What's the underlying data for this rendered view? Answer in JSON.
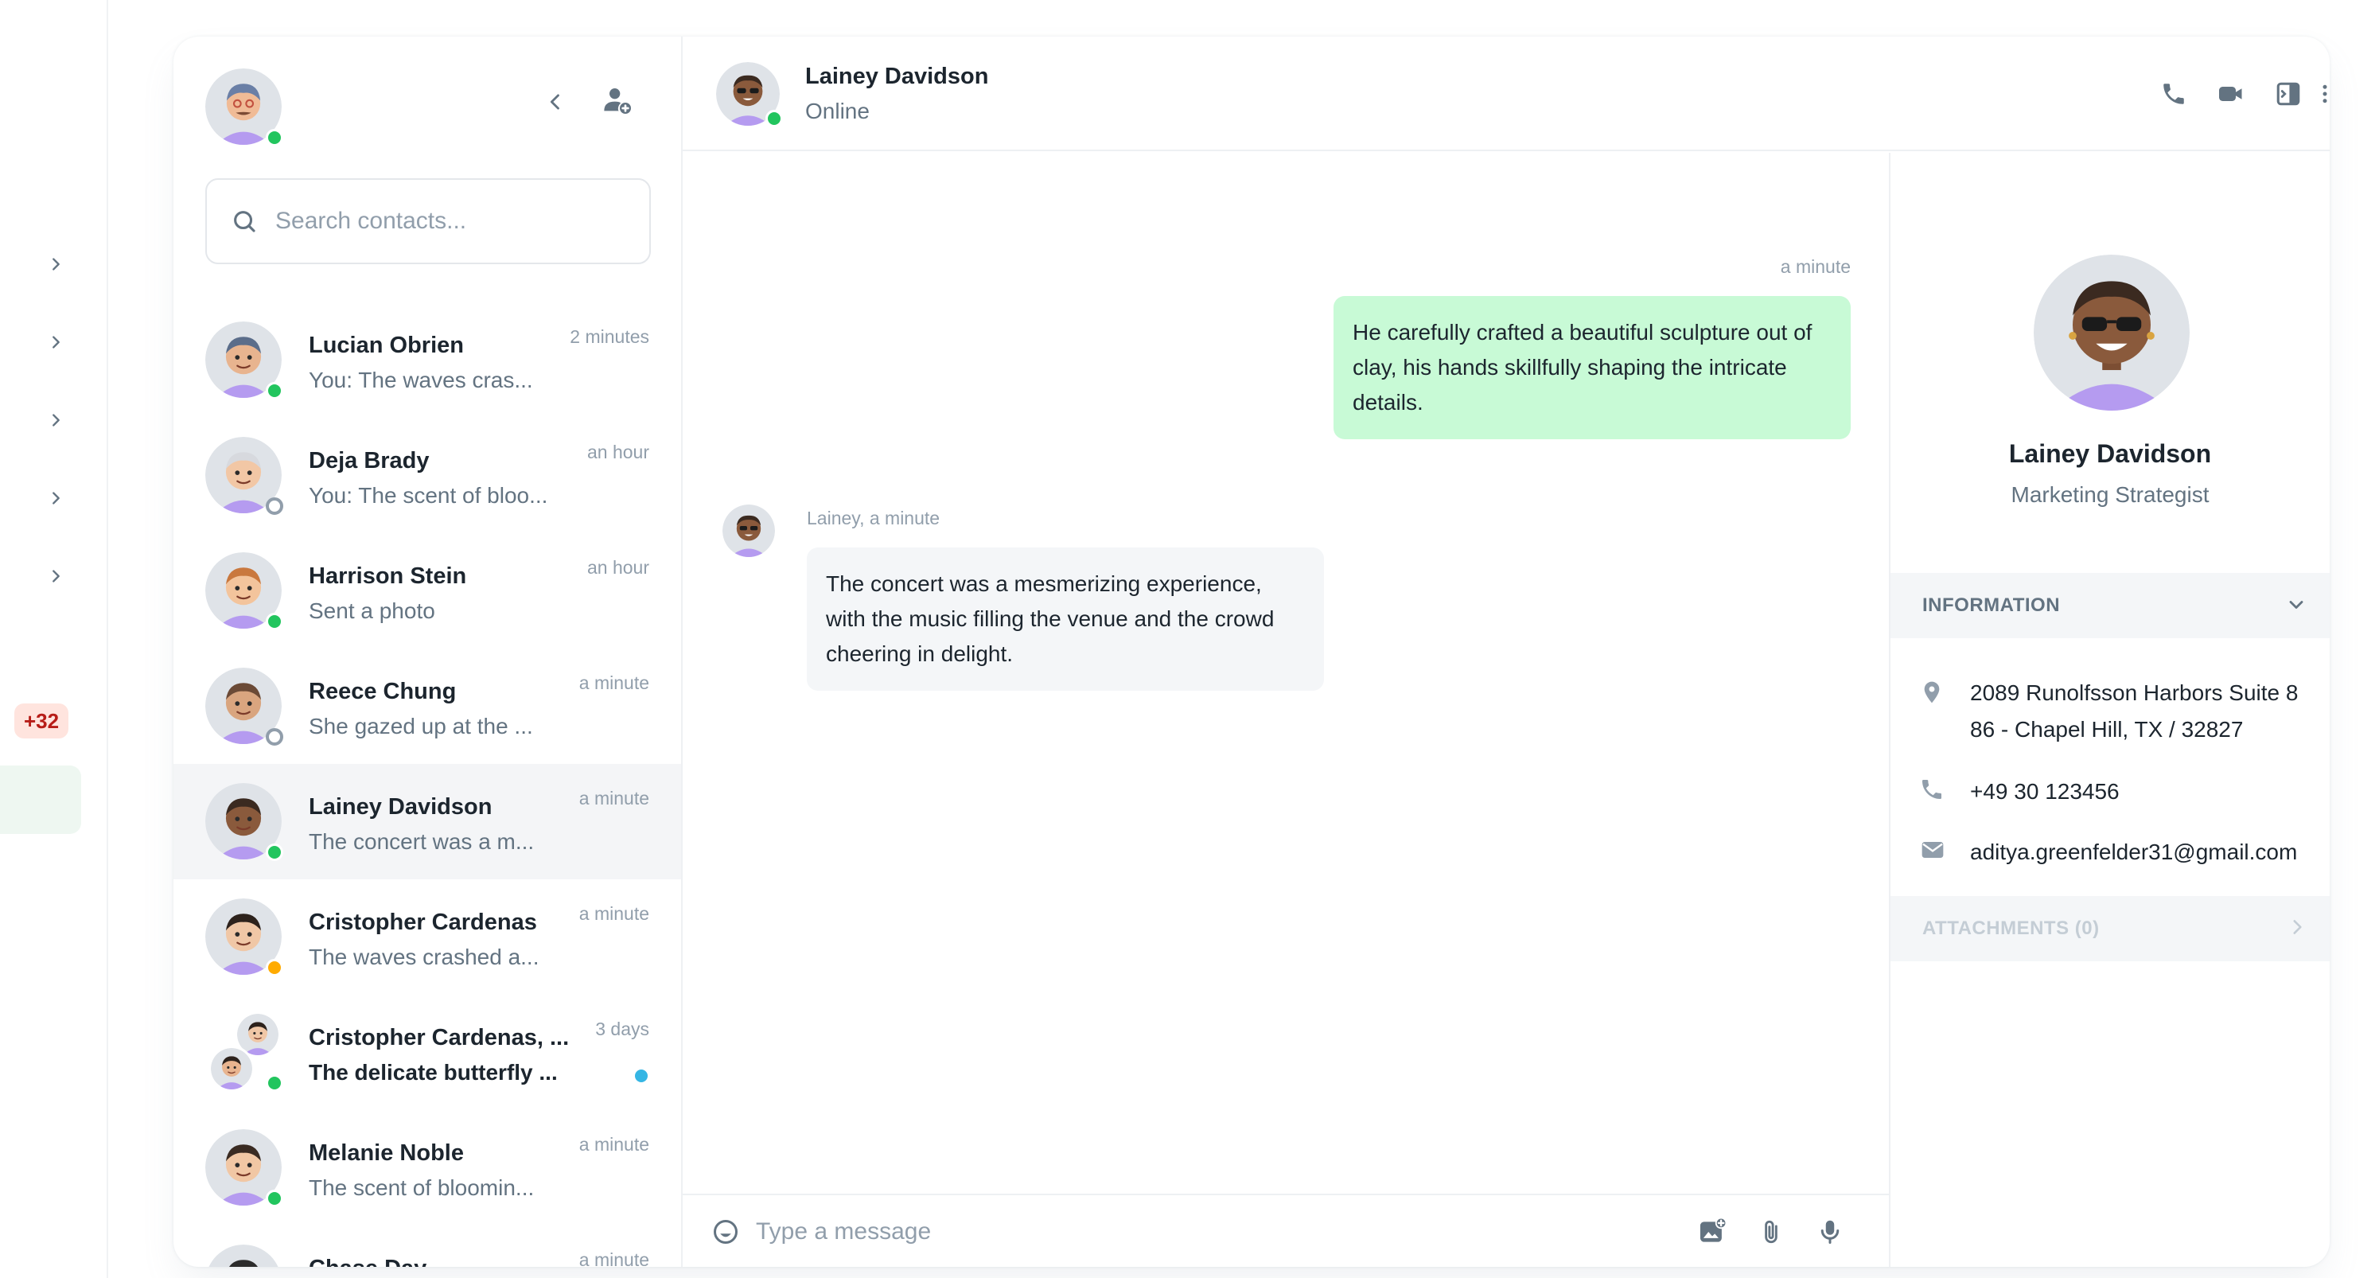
{
  "rail": {
    "badge": "+32"
  },
  "me": {
    "status": "online"
  },
  "search": {
    "placeholder": "Search contacts..."
  },
  "contacts": [
    {
      "name": "Lucian Obrien",
      "message": "You: The waves cras...",
      "time": "2 minutes",
      "status": "online",
      "skin": "#e8b48f",
      "hair": "#5b6d8a",
      "unread": false,
      "active": false
    },
    {
      "name": "Deja Brady",
      "message": "You: The scent of bloo...",
      "time": "an hour",
      "status": "offline",
      "skin": "#f2c7a5",
      "hair": "#d7d9de",
      "unread": false,
      "active": false
    },
    {
      "name": "Harrison Stein",
      "message": "Sent a photo",
      "time": "an hour",
      "status": "online",
      "skin": "#f3c49c",
      "hair": "#c9783e",
      "unread": false,
      "active": false
    },
    {
      "name": "Reece Chung",
      "message": "She gazed up at the ...",
      "time": "a minute",
      "status": "offline",
      "skin": "#d9a57f",
      "hair": "#6b4a36",
      "unread": false,
      "active": false
    },
    {
      "name": "Lainey Davidson",
      "message": "The concert was a m...",
      "time": "a minute",
      "status": "online",
      "skin": "#8a5a3c",
      "hair": "#3b2a20",
      "unread": false,
      "active": true
    },
    {
      "name": "Cristopher Cardenas",
      "message": "The waves crashed a...",
      "time": "a minute",
      "status": "away",
      "skin": "#f0c7a6",
      "hair": "#2d221c",
      "unread": false,
      "active": false
    },
    {
      "name": "Cristopher Cardenas, ...",
      "message": "The delicate butterfly ...",
      "time": "3 days",
      "status": "online",
      "skin": "#e8b48f",
      "hair": "#2d221c",
      "unread": true,
      "active": false,
      "group": true
    },
    {
      "name": "Melanie Noble",
      "message": "The scent of bloomin...",
      "time": "a minute",
      "status": "online",
      "skin": "#f1c7a4",
      "hair": "#3a2b22",
      "unread": false,
      "active": false
    },
    {
      "name": "Chase Day",
      "message": "",
      "time": "a minute",
      "status": "online",
      "skin": "#e6b08a",
      "hair": "#2b2b2b",
      "unread": false,
      "active": false
    }
  ],
  "conversation": {
    "name": "Lainey Davidson",
    "status": "Online"
  },
  "messages": {
    "outgoing_time": "a minute",
    "outgoing_text": "He carefully crafted a beautiful sculpture out of clay, his hands skillfully shaping the intricate details.",
    "incoming_meta": "Lainey, a minute",
    "incoming_text": "The concert was a mesmerizing experience, with the music filling the venue and the crowd cheering in delight."
  },
  "composer": {
    "placeholder": "Type a message"
  },
  "details": {
    "name": "Lainey Davidson",
    "role": "Marketing Strategist",
    "info_label": "INFORMATION",
    "address": "2089 Runolfsson Harbors Suite 886 - Chapel Hill, TX / 32827",
    "address_line1": "2089 Runolfsson Harbors Suite 8",
    "address_line2": "86 - Chapel Hill, TX / 32827",
    "phone": "+49 30 123456",
    "email": "aditya.greenfelder31@gmail.com",
    "attachments_label": "ATTACHMENTS (0)"
  },
  "colors": {
    "online": "#22c55e",
    "away": "#ffab00",
    "outgoing_bubble": "#c8fad6",
    "incoming_bubble": "#f4f6f8",
    "unread": "#35b6e4"
  },
  "icons": {
    "rail": "chevron-right-icon",
    "collapse": "chevron-left-icon",
    "add_contact": "add-user-icon",
    "search": "search-icon",
    "call": "phone-icon",
    "video": "video-camera-icon",
    "sidebar": "sidebar-toggle-icon",
    "more": "more-vertical-icon",
    "emoji": "emoji-icon",
    "image": "image-add-icon",
    "attach": "paperclip-icon",
    "mic": "microphone-icon",
    "location": "location-pin-icon",
    "email": "mail-icon"
  }
}
